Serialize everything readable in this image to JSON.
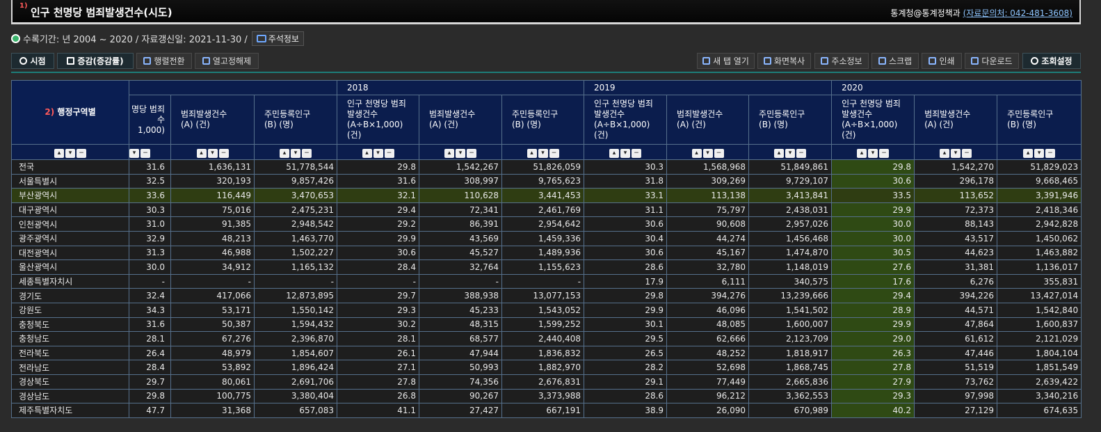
{
  "header": {
    "footnote": "1)",
    "title": "인구 천명당 범죄발생건수(시도)",
    "source": "통계청@통계정책과",
    "contact": "(자료문의처: 042-481-3608)"
  },
  "info": {
    "period": "수록기간: 년 2004 ~ 2020 / 자료갱신일: 2021-11-30 /",
    "notes_button": "주석정보"
  },
  "toolbar": {
    "left": [
      "시점",
      "증감(증감률)",
      "행렬전환",
      "열고정해제"
    ],
    "right": [
      "새 탭 열기",
      "화면복사",
      "주소정보",
      "스크랩",
      "인쇄",
      "다운로드",
      "조회설정"
    ]
  },
  "table": {
    "row_header_num": "2)",
    "row_header": "행정구역별",
    "years": [
      "2018",
      "2019",
      "2020"
    ],
    "partial_col_label": [
      "명당 범죄",
      "수",
      "1,000)"
    ],
    "col_labels": [
      [
        "인구 천명당 범죄",
        "발생건수",
        "(A÷B×1,000)",
        "(건)"
      ],
      [
        "범죄발생건수",
        "(A) (건)"
      ],
      [
        "주민등록인구",
        "(B) (명)"
      ]
    ],
    "rows": [
      {
        "name": "전국",
        "v": [
          "31.6",
          "1,636,131",
          "51,778,544",
          "29.8",
          "1,542,267",
          "51,826,059",
          "30.3",
          "1,568,968",
          "51,849,861",
          "29.8",
          "1,542,270",
          "51,829,023"
        ]
      },
      {
        "name": "서울특별시",
        "v": [
          "32.5",
          "320,193",
          "9,857,426",
          "31.6",
          "308,997",
          "9,765,623",
          "31.8",
          "309,269",
          "9,729,107",
          "30.6",
          "296,178",
          "9,668,465"
        ]
      },
      {
        "name": "부산광역시",
        "v": [
          "33.6",
          "116,449",
          "3,470,653",
          "32.1",
          "110,628",
          "3,441,453",
          "33.1",
          "113,138",
          "3,413,841",
          "33.5",
          "113,652",
          "3,391,946"
        ]
      },
      {
        "name": "대구광역시",
        "v": [
          "30.3",
          "75,016",
          "2,475,231",
          "29.4",
          "72,341",
          "2,461,769",
          "31.1",
          "75,797",
          "2,438,031",
          "29.9",
          "72,373",
          "2,418,346"
        ]
      },
      {
        "name": "인천광역시",
        "v": [
          "31.0",
          "91,385",
          "2,948,542",
          "29.2",
          "86,391",
          "2,954,642",
          "30.6",
          "90,608",
          "2,957,026",
          "30.0",
          "88,143",
          "2,942,828"
        ]
      },
      {
        "name": "광주광역시",
        "v": [
          "32.9",
          "48,213",
          "1,463,770",
          "29.9",
          "43,569",
          "1,459,336",
          "30.4",
          "44,274",
          "1,456,468",
          "30.0",
          "43,517",
          "1,450,062"
        ]
      },
      {
        "name": "대전광역시",
        "v": [
          "31.3",
          "46,988",
          "1,502,227",
          "30.6",
          "45,527",
          "1,489,936",
          "30.6",
          "45,167",
          "1,474,870",
          "30.5",
          "44,623",
          "1,463,882"
        ]
      },
      {
        "name": "울산광역시",
        "v": [
          "30.0",
          "34,912",
          "1,165,132",
          "28.4",
          "32,764",
          "1,155,623",
          "28.6",
          "32,780",
          "1,148,019",
          "27.6",
          "31,381",
          "1,136,017"
        ]
      },
      {
        "name": "세종특별자치시",
        "v": [
          "-",
          "-",
          "-",
          "-",
          "-",
          "-",
          "17.9",
          "6,111",
          "340,575",
          "17.6",
          "6,276",
          "355,831"
        ]
      },
      {
        "name": "경기도",
        "v": [
          "32.4",
          "417,066",
          "12,873,895",
          "29.7",
          "388,938",
          "13,077,153",
          "29.8",
          "394,276",
          "13,239,666",
          "29.4",
          "394,226",
          "13,427,014"
        ]
      },
      {
        "name": "강원도",
        "v": [
          "34.3",
          "53,171",
          "1,550,142",
          "29.3",
          "45,233",
          "1,543,052",
          "29.9",
          "46,096",
          "1,541,502",
          "28.9",
          "44,571",
          "1,542,840"
        ]
      },
      {
        "name": "충청북도",
        "v": [
          "31.6",
          "50,387",
          "1,594,432",
          "30.2",
          "48,315",
          "1,599,252",
          "30.1",
          "48,085",
          "1,600,007",
          "29.9",
          "47,864",
          "1,600,837"
        ]
      },
      {
        "name": "충청남도",
        "v": [
          "28.1",
          "67,276",
          "2,396,870",
          "28.1",
          "68,577",
          "2,440,408",
          "29.5",
          "62,666",
          "2,123,709",
          "29.0",
          "61,612",
          "2,121,029"
        ]
      },
      {
        "name": "전라북도",
        "v": [
          "26.4",
          "48,979",
          "1,854,607",
          "26.1",
          "47,944",
          "1,836,832",
          "26.5",
          "48,252",
          "1,818,917",
          "26.3",
          "47,446",
          "1,804,104"
        ]
      },
      {
        "name": "전라남도",
        "v": [
          "28.4",
          "53,892",
          "1,896,424",
          "27.1",
          "50,993",
          "1,882,970",
          "28.2",
          "52,698",
          "1,868,745",
          "27.8",
          "51,519",
          "1,851,549"
        ]
      },
      {
        "name": "경상북도",
        "v": [
          "29.7",
          "80,061",
          "2,691,706",
          "27.8",
          "74,356",
          "2,676,831",
          "29.1",
          "77,449",
          "2,665,836",
          "27.9",
          "73,762",
          "2,639,422"
        ]
      },
      {
        "name": "경상남도",
        "v": [
          "29.8",
          "100,775",
          "3,380,404",
          "26.8",
          "90,267",
          "3,373,988",
          "28.6",
          "96,212",
          "3,362,553",
          "29.3",
          "97,998",
          "3,340,216"
        ]
      },
      {
        "name": "제주특별자치도",
        "v": [
          "47.7",
          "31,368",
          "657,083",
          "41.1",
          "27,427",
          "667,191",
          "38.9",
          "26,090",
          "670,989",
          "40.2",
          "27,129",
          "674,635"
        ]
      }
    ]
  },
  "colors": {
    "header_bg": "#0b1d4d",
    "highlight_row": "#2f3d12",
    "highlight_col": "#2f4a14",
    "accent": "#1d7d79"
  }
}
